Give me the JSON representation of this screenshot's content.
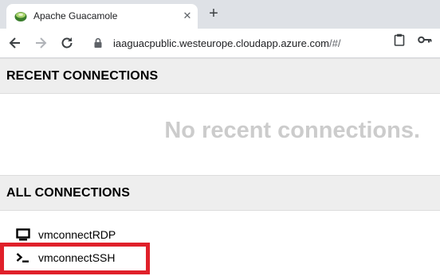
{
  "browser": {
    "tab_title": "Apache Guacamole",
    "url_host": "iaaguacpublic.westeurope.cloudapp.azure.com",
    "url_path": "/#/"
  },
  "recent": {
    "header": "RECENT CONNECTIONS",
    "empty_message": "No recent connections."
  },
  "all": {
    "header": "ALL CONNECTIONS",
    "connections": [
      {
        "label": "vmconnectRDP",
        "icon": "desktop-icon"
      },
      {
        "label": "vmconnectSSH",
        "icon": "terminal-icon"
      }
    ]
  },
  "highlight_color": "#e0202a"
}
